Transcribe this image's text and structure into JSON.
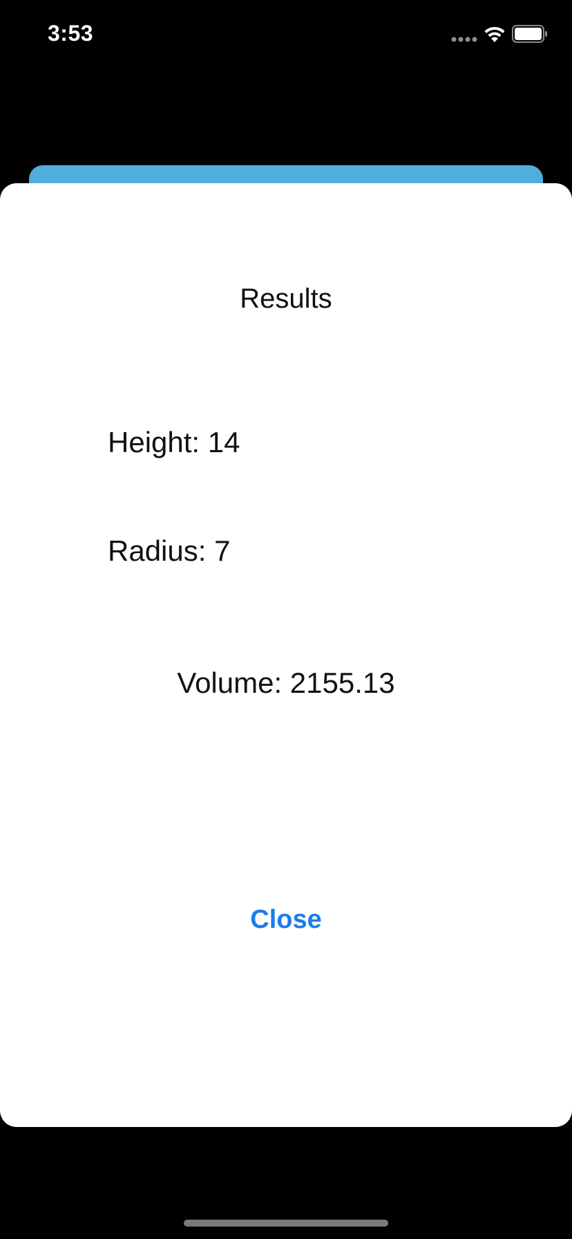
{
  "status_bar": {
    "time": "3:53",
    "signal_icon": "cellular-dots-icon",
    "wifi_icon": "wifi-icon",
    "battery_icon": "battery-icon"
  },
  "background_card": {
    "color": "#4FAEDB"
  },
  "sheet": {
    "title": "Results",
    "height_text": "Height: 14",
    "radius_text": "Radius: 7",
    "volume_text": "Volume: 2155.13",
    "close_label": "Close"
  },
  "colors": {
    "accent": "#1C7CEB",
    "sheet_background": "#FFFFFF",
    "screen_background": "#000000"
  }
}
